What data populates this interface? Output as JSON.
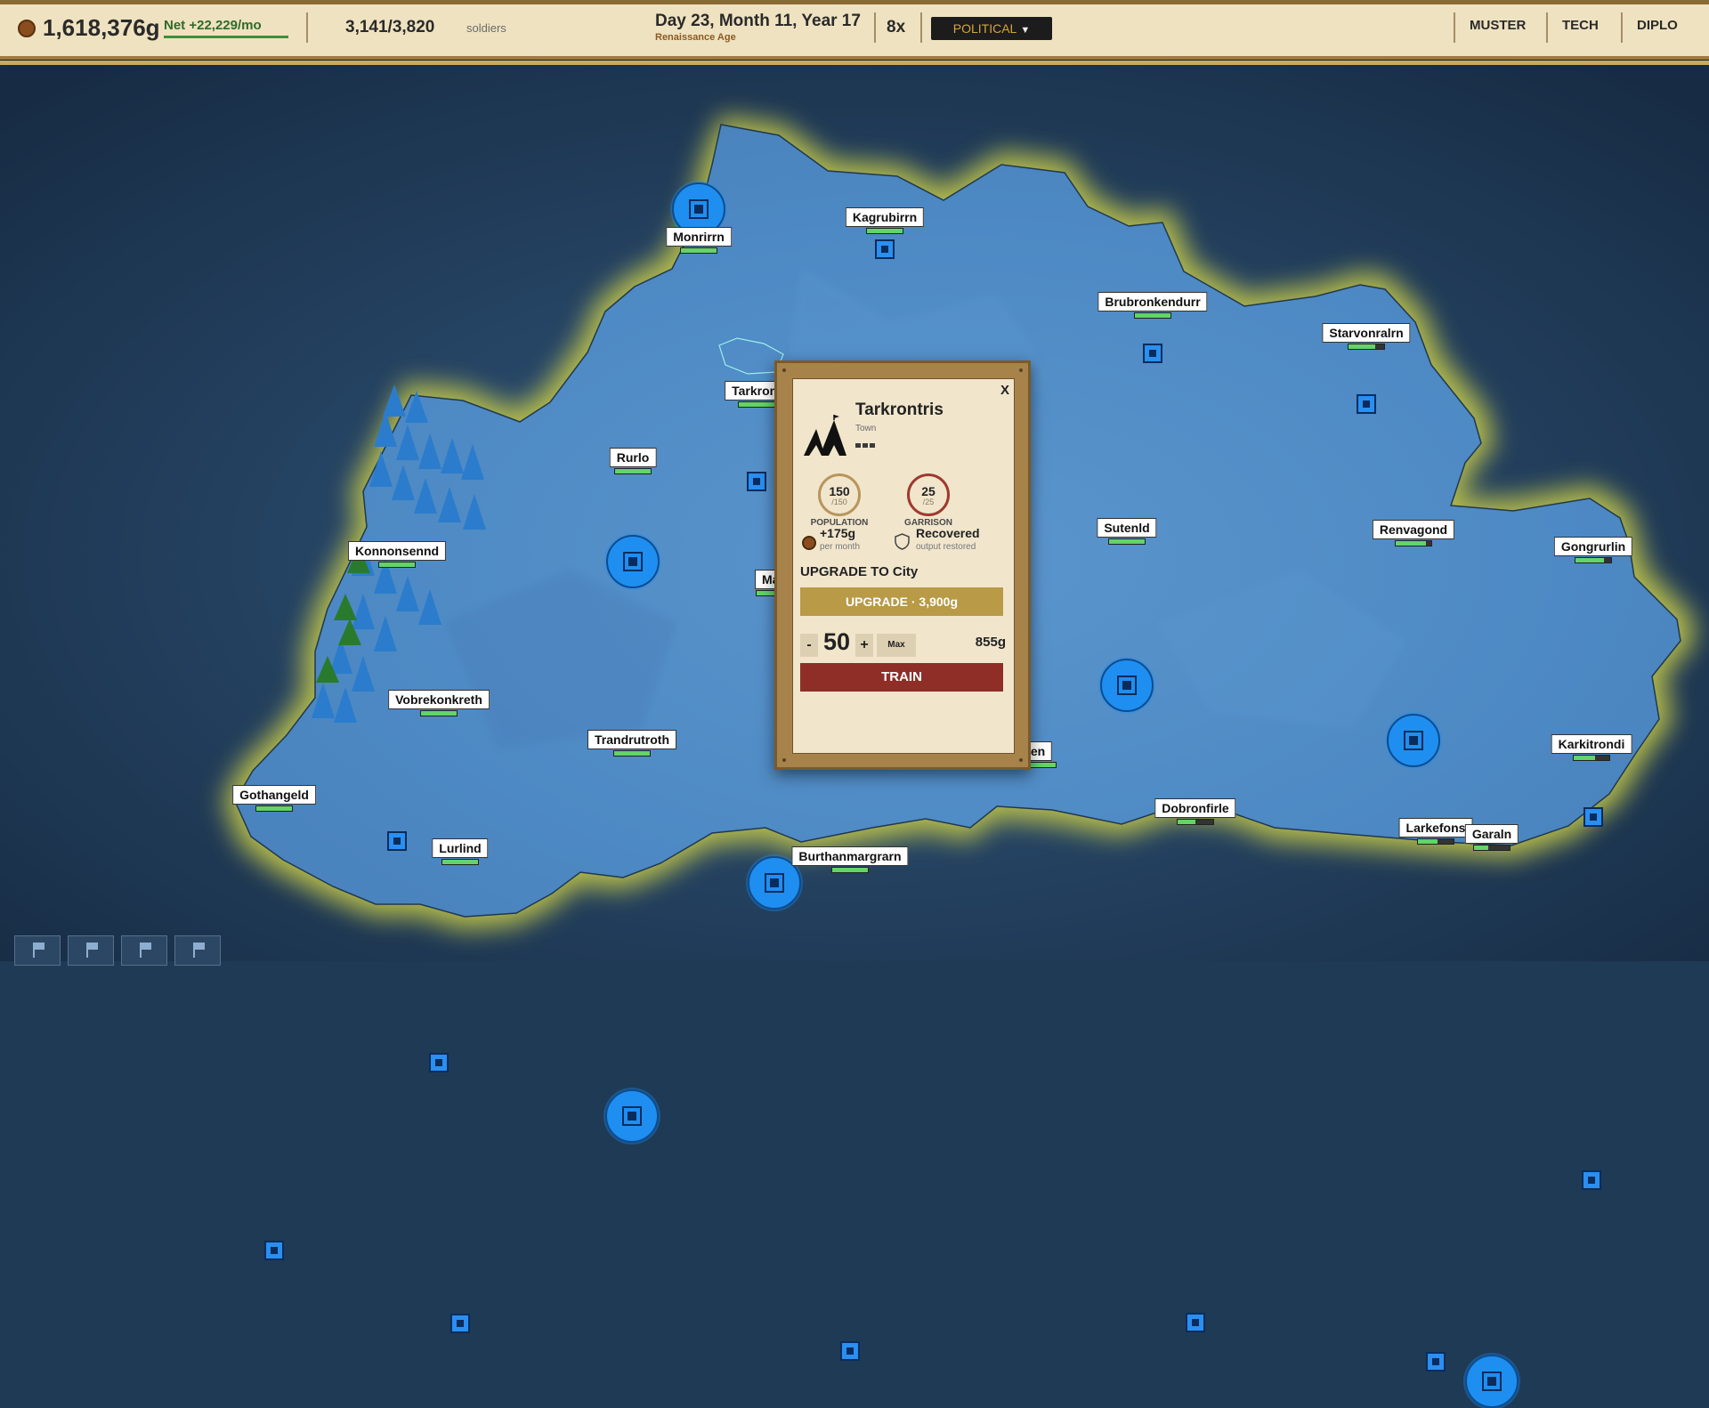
{
  "topbar": {
    "gold": "1,618,376g",
    "net": "Net +22,229/mo",
    "soldiers": "3,141/3,820",
    "soldiers_label": "soldiers",
    "date": "Day 23, Month 11, Year 17",
    "age": "Renaissance Age",
    "speed": "8x",
    "mode": "POLITICAL",
    "nav": [
      "MUSTER",
      "TECH",
      "DIPLO"
    ]
  },
  "regions": [
    {
      "name": "Monrirrn",
      "type": "big",
      "health": 1.0
    },
    {
      "name": "Kagrubirrn",
      "type": "small",
      "health": 1.0
    },
    {
      "name": "Brubronkendurr",
      "type": "small",
      "health": 1.0
    },
    {
      "name": "Starvonralrn",
      "type": "small",
      "health": 0.75
    },
    {
      "name": "Tarkrontris",
      "label": "Tarkront",
      "type": "small",
      "health": 1.0
    },
    {
      "name": "Rurlo",
      "type": "big",
      "health": 1.0
    },
    {
      "name": "Sutenld",
      "type": "big",
      "health": 1.0
    },
    {
      "name": "Renvagond",
      "type": "big",
      "health": 0.85
    },
    {
      "name": "Gongrurlin",
      "type": "small",
      "health": 0.8
    },
    {
      "name": "Konnonsennd",
      "type": "small",
      "health": 1.0
    },
    {
      "name": "Man",
      "type": "big",
      "health": 1.0
    },
    {
      "name": "Vobrekonkreth",
      "type": "small",
      "health": 1.0
    },
    {
      "name": "Trandrutroth",
      "type": "big",
      "health": 1.0
    },
    {
      "name": "en",
      "type": "hidden",
      "health": 1.0
    },
    {
      "name": "Karkitrondi",
      "type": "small",
      "health": 0.6
    },
    {
      "name": "Gothangeld",
      "type": "small",
      "health": 1.0
    },
    {
      "name": "Lurlind",
      "type": "small",
      "health": 1.0
    },
    {
      "name": "Burthanmargrarn",
      "type": "small",
      "health": 1.0
    },
    {
      "name": "Dobronfirle",
      "type": "small",
      "health": 0.5
    },
    {
      "name": "Larkefons",
      "type": "small",
      "health": 0.55
    },
    {
      "name": "Garaln",
      "type": "big",
      "health": 0.4
    }
  ],
  "popup": {
    "close": "X",
    "name": "Tarkrontris",
    "type": "Town",
    "population": "150",
    "population_max": "/150",
    "population_label": "POPULATION",
    "garrison": "25",
    "garrison_max": "/25",
    "garrison_label": "GARRISON",
    "income": "+175g",
    "income_sub": "per month",
    "status": "Recovered",
    "status_sub": "output restored",
    "upgrade_title": "UPGRADE TO City",
    "upgrade_btn": "UPGRADE · 3,900g",
    "minus": "-",
    "quantity": "50",
    "plus": "+",
    "max": "Max",
    "cost": "855g",
    "train": "TRAIN"
  },
  "colors": {
    "player_blue": "#1e8ff0",
    "topbar_bg": "#efe2c0",
    "train": "#8e2e27",
    "upgrade": "#b89a47",
    "health_green": "#63d46a"
  },
  "icons": [
    "coin-icon",
    "chevron-down-icon",
    "castle-icon",
    "town-icon",
    "shield-icon",
    "flag-icon",
    "tree-icon"
  ]
}
